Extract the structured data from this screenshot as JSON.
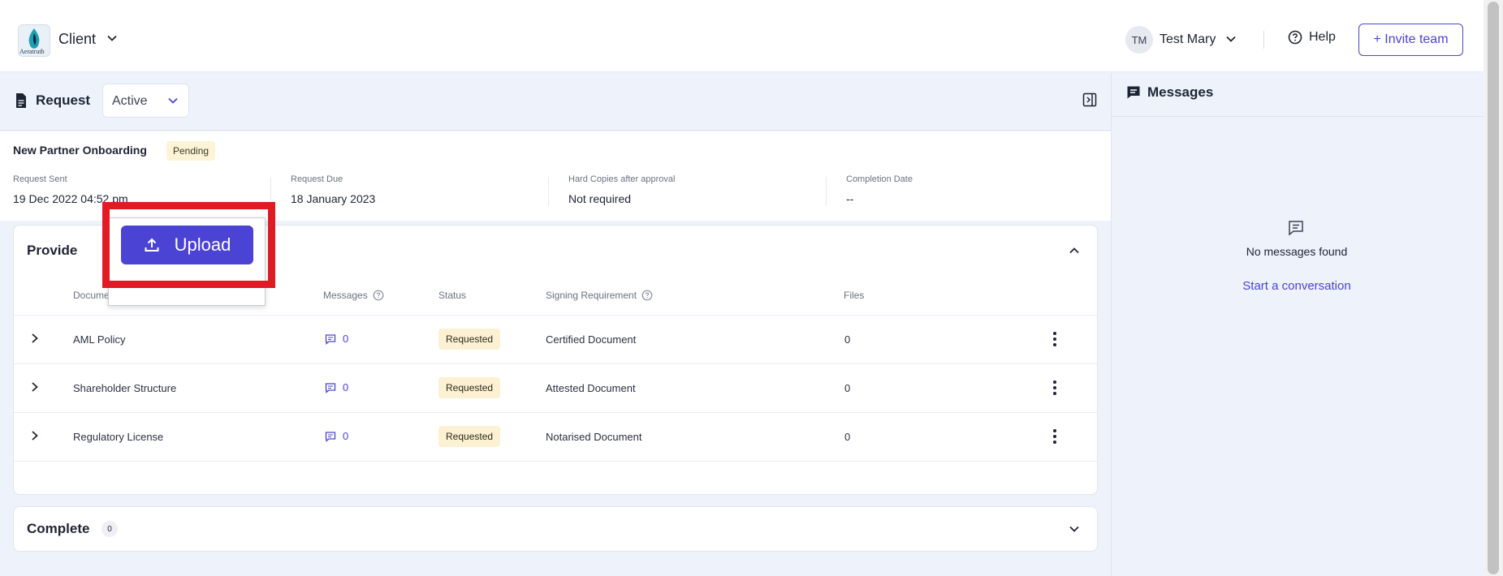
{
  "header": {
    "logo_text": "Aeratruth",
    "client_label": "Client",
    "user_initials": "TM",
    "user_name": "Test Mary",
    "help_label": "Help",
    "invite_label": "+ Invite team"
  },
  "request_bar": {
    "title": "Request",
    "status_value": "Active"
  },
  "request": {
    "name": "New Partner Onboarding",
    "status_badge": "Pending",
    "meta": [
      {
        "label": "Request Sent",
        "value": "19 Dec 2022 04:52 pm"
      },
      {
        "label": "Request Due",
        "value": "18 January 2023"
      },
      {
        "label": "Hard Copies after approval",
        "value": "Not required"
      },
      {
        "label": "Completion Date",
        "value": "--"
      }
    ]
  },
  "provide": {
    "title": "Provide",
    "columns": [
      "Document",
      "Messages",
      "Status",
      "Signing Requirement",
      "Files"
    ],
    "rows": [
      {
        "document": "AML Policy",
        "messages": "0",
        "status": "Requested",
        "signing": "Certified Document",
        "files": "0"
      },
      {
        "document": "Shareholder Structure",
        "messages": "0",
        "status": "Requested",
        "signing": "Attested Document",
        "files": "0"
      },
      {
        "document": "Regulatory License",
        "messages": "0",
        "status": "Requested",
        "signing": "Notarised Document",
        "files": "0"
      }
    ]
  },
  "popup": {
    "upload_label": "Upload"
  },
  "complete": {
    "title": "Complete",
    "count": "0"
  },
  "messages": {
    "title": "Messages",
    "empty_text": "No messages found",
    "start_link": "Start a conversation"
  },
  "colors": {
    "accent": "#4b43d4",
    "highlight": "#e01b24",
    "badge_bg": "#fdf1d3"
  }
}
